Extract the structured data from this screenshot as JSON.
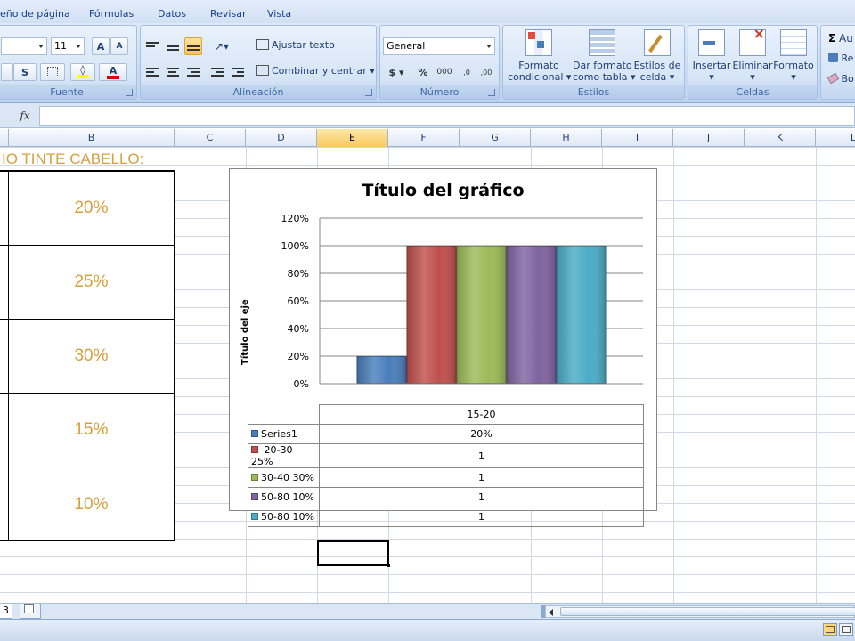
{
  "menu": {
    "tabs": [
      "eño de página",
      "Fórmulas",
      "Datos",
      "Revisar",
      "Vista"
    ]
  },
  "ribbon": {
    "font_group": {
      "title": "Fuente",
      "font_size": "11"
    },
    "alignment_group": {
      "title": "Alineación",
      "wrap_text": "Ajustar texto",
      "merge_center": "Combinar y centrar"
    },
    "number_group": {
      "title": "Número",
      "format": "General"
    },
    "styles_group": {
      "title": "Estilos",
      "conditional_format": [
        "Formato",
        "condicional"
      ],
      "format_table": [
        "Dar formato",
        "como tabla"
      ],
      "cell_styles": [
        "Estilos de",
        "celda"
      ]
    },
    "cells_group": {
      "title": "Celdas",
      "insert": "Insertar",
      "delete": "Eliminar",
      "format": "Formato"
    },
    "editing_group": {
      "autosum": "Au",
      "fill": "Re",
      "clear": "Bo"
    }
  },
  "formula_bar": {
    "fx": "fx",
    "value": ""
  },
  "columns": [
    "B",
    "C",
    "D",
    "E",
    "F",
    "G",
    "H",
    "I",
    "J",
    "K",
    "L"
  ],
  "selected_column": "E",
  "sheet": {
    "title": "IO TINTE CABELLO:",
    "values": [
      "20%",
      "25%",
      "30%",
      "15%",
      "10%"
    ]
  },
  "chart_data": {
    "type": "bar",
    "title": "Título del gráfico",
    "ylabel": "Título del eje",
    "xlabel": "",
    "categories": [
      "15-20"
    ],
    "ylim": [
      0,
      1.2
    ],
    "yticks": [
      "0%",
      "20%",
      "40%",
      "60%",
      "80%",
      "100%",
      "120%"
    ],
    "grid": true,
    "legend": "data-table",
    "series": [
      {
        "name": "Series1",
        "values": [
          0.2
        ],
        "table_value": "20%",
        "color": "#4a7ebb"
      },
      {
        "name": " 20-30 25%",
        "values": [
          1
        ],
        "table_value": "1",
        "color": "#c0504d"
      },
      {
        "name": "30-40 30%",
        "values": [
          1
        ],
        "table_value": "1",
        "color": "#9bbb59"
      },
      {
        "name": "50-80 10%",
        "values": [
          1
        ],
        "table_value": "1",
        "color": "#8064a2"
      },
      {
        "name": "50-80 10%",
        "values": [
          1
        ],
        "table_value": "1",
        "color": "#4bacc6"
      }
    ]
  },
  "sheet_tabs": {
    "visible_tab": "3"
  }
}
